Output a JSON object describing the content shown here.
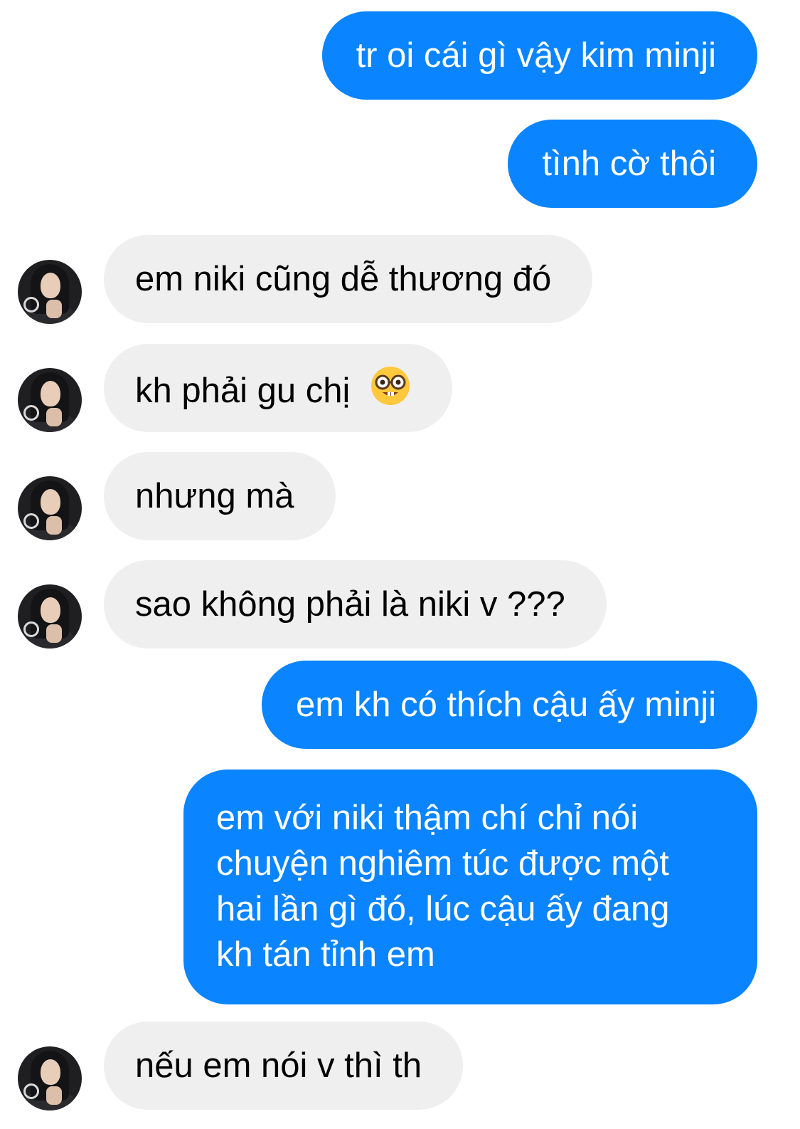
{
  "messages": [
    {
      "from": "me",
      "text": "tr oi cái gì vậy kim minji"
    },
    {
      "from": "me",
      "text": "tình cờ thôi"
    },
    {
      "from": "them",
      "text": "em niki cũng dễ thương đó"
    },
    {
      "from": "them",
      "text": "kh phải gu chị",
      "emoji": "nerd-face-emoji"
    },
    {
      "from": "them",
      "text": "nhưng mà"
    },
    {
      "from": "them",
      "text": "sao không phải là niki v ???"
    },
    {
      "from": "me",
      "text": "em kh có thích cậu ấy minji"
    },
    {
      "from": "me",
      "lines": [
        "em với niki thậm chí chỉ nói",
        "chuyện nghiêm túc được một",
        "hai lần gì đó, lúc cậu ấy đang",
        "kh tán tỉnh em"
      ]
    },
    {
      "from": "them",
      "text": "nếu em nói v thì th"
    }
  ],
  "colors": {
    "outgoing_bubble": "#0a84ff",
    "incoming_bubble": "#efefef"
  }
}
